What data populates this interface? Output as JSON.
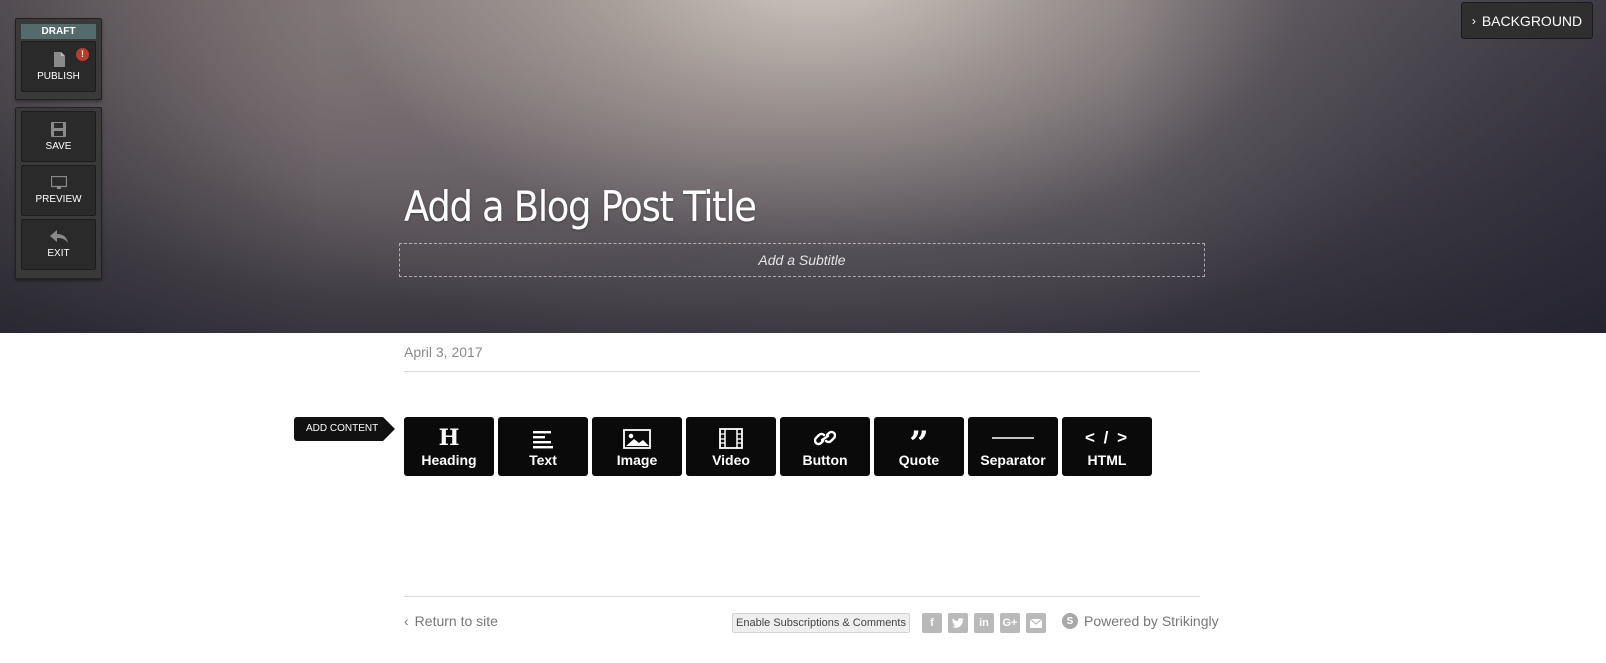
{
  "editor_toolbar": {
    "status_badge": "DRAFT",
    "publish": {
      "label": "PUBLISH",
      "alert": "!"
    },
    "save": {
      "label": "SAVE"
    },
    "preview": {
      "label": "PREVIEW"
    },
    "exit": {
      "label": "EXIT"
    }
  },
  "hero": {
    "background_button": "BACKGROUND",
    "title": "Add a Blog Post Title",
    "subtitle_placeholder": "Add a Subtitle"
  },
  "post": {
    "date": "April 3, 2017"
  },
  "add_content": {
    "tag_label": "ADD CONTENT",
    "buttons": [
      {
        "label": "Heading",
        "icon": "heading-icon"
      },
      {
        "label": "Text",
        "icon": "text-lines-icon"
      },
      {
        "label": "Image",
        "icon": "image-icon"
      },
      {
        "label": "Video",
        "icon": "film-icon"
      },
      {
        "label": "Button",
        "icon": "link-icon"
      },
      {
        "label": "Quote",
        "icon": "quote-icon"
      },
      {
        "label": "Separator",
        "icon": "separator-line-icon"
      },
      {
        "label": "HTML",
        "icon": "code-icon"
      }
    ]
  },
  "footer": {
    "return_link": "Return to site",
    "enable_button": "Enable Subscriptions & Comments",
    "social": [
      "f",
      "t",
      "in",
      "G+",
      "mail"
    ],
    "powered_by": "Powered by Strikingly"
  },
  "colors": {
    "toolbar_bg": "#3a3a3a",
    "draft_badge": "#556a6b",
    "alert": "#c0392b",
    "content_button_bg": "#0a0a0a"
  }
}
